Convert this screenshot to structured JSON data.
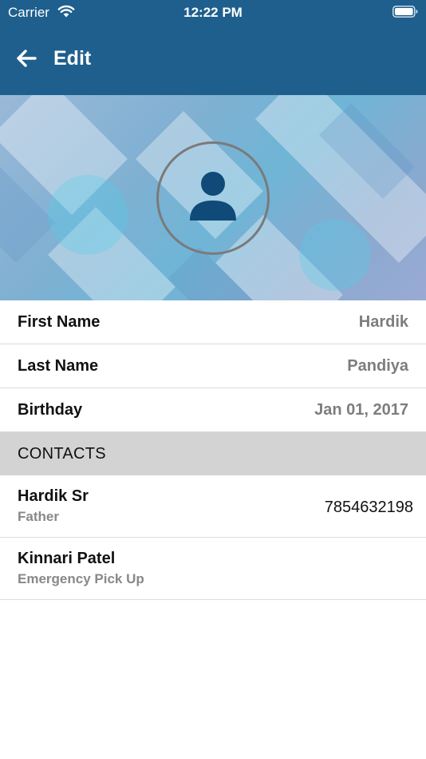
{
  "status_bar": {
    "carrier": "Carrier",
    "time": "12:22 PM"
  },
  "nav": {
    "title": "Edit",
    "back_icon": "arrow-left-icon"
  },
  "profile": {
    "avatar_icon": "person-icon"
  },
  "fields": [
    {
      "label": "First Name",
      "value": "Hardik"
    },
    {
      "label": "Last Name",
      "value": "Pandiya"
    },
    {
      "label": "Birthday",
      "value": "Jan 01, 2017"
    }
  ],
  "contacts_section": {
    "title": "CONTACTS",
    "items": [
      {
        "name": "Hardik Sr",
        "relation": "Father",
        "phone": "7854632198"
      },
      {
        "name": "Kinnari Patel",
        "relation": "Emergency Pick Up",
        "phone": ""
      }
    ]
  },
  "colors": {
    "nav_background": "#1f5f8e",
    "avatar_icon": "#0f4a78",
    "section_background": "#d3d3d3",
    "value_text": "#7d7d7d"
  }
}
